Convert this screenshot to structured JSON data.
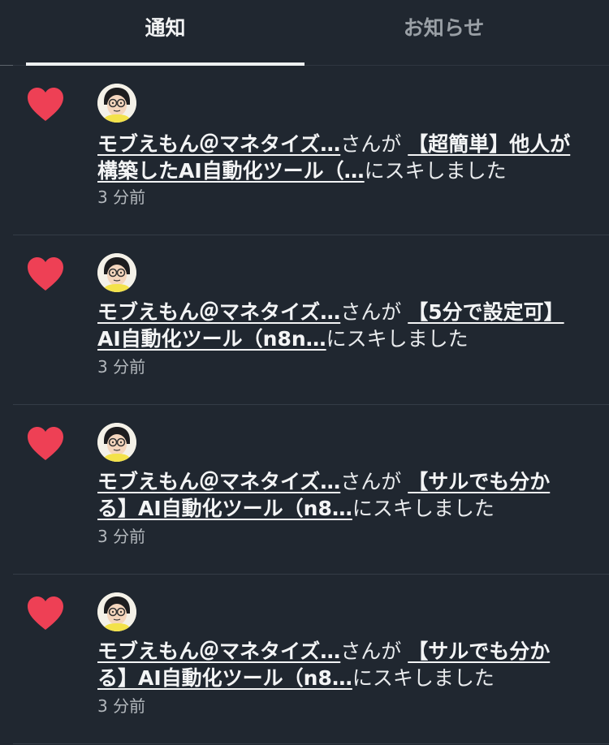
{
  "tabs": {
    "notifications": "通知",
    "announcements": "お知らせ"
  },
  "colors": {
    "background": "#202730",
    "heart": "#ee4055"
  },
  "notifications": [
    {
      "user": "モブえもん＠マネタイズ…",
      "verb": "さんが",
      "article_line1": "【超簡単】他人が",
      "article_line2": "構築したAI自動化ツール（…",
      "action": "にスキしました",
      "time": "3 分前",
      "icon": "heart-icon"
    },
    {
      "user": "モブえもん＠マネタイズ…",
      "verb": "さんが",
      "article_line1": "【5分で設定可】",
      "article_line2": "AI自動化ツール（n8n…",
      "action": "にスキしました",
      "time": "3 分前",
      "icon": "heart-icon"
    },
    {
      "user": "モブえもん＠マネタイズ…",
      "verb": "さんが",
      "article_line1": "【サルでも分か",
      "article_line2": "る】AI自動化ツール（n8…",
      "action": "にスキしました",
      "time": "3 分前",
      "icon": "heart-icon"
    },
    {
      "user": "モブえもん＠マネタイズ…",
      "verb": "さんが",
      "article_line1": "【サルでも分か",
      "article_line2": "る】AI自動化ツール（n8…",
      "action": "にスキしました",
      "time": "3 分前",
      "icon": "heart-icon"
    }
  ]
}
